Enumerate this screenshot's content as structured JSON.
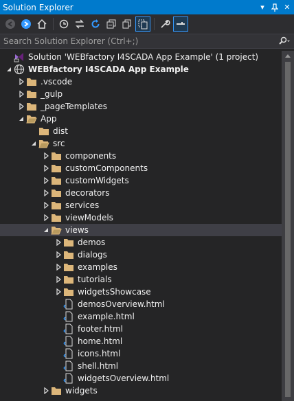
{
  "window": {
    "title": "Solution Explorer",
    "dropdown_icon": "caret-down-icon",
    "pin_icon": "pin-icon",
    "close_icon": "close-icon"
  },
  "toolbar": {
    "buttons": [
      "back-arrow-icon",
      "forward-arrow-icon",
      "home-icon",
      "history-icon",
      "sync-icon",
      "refresh-icon",
      "collapse-all-icon",
      "copy-icon",
      "show-all-files-icon",
      "properties-wrench-icon",
      "preview-icon"
    ]
  },
  "search": {
    "placeholder": "Search Solution Explorer (Ctrl+;)",
    "icon": "search-icon"
  },
  "tree": {
    "rows": [
      {
        "label": "Solution 'WEBfactory I4SCADA App Example' (1 project)",
        "type": "solution",
        "bold": false
      },
      {
        "label": "WEBfactory I4SCADA App Example",
        "type": "project",
        "bold": true
      },
      {
        "label": ".vscode",
        "type": "folder"
      },
      {
        "label": "_gulp",
        "type": "folder"
      },
      {
        "label": "_pageTemplates",
        "type": "folder"
      },
      {
        "label": "App",
        "type": "folder-open"
      },
      {
        "label": "dist",
        "type": "folder"
      },
      {
        "label": "src",
        "type": "folder-open"
      },
      {
        "label": "components",
        "type": "folder"
      },
      {
        "label": "customComponents",
        "type": "folder"
      },
      {
        "label": "customWidgets",
        "type": "folder"
      },
      {
        "label": "decorators",
        "type": "folder"
      },
      {
        "label": "services",
        "type": "folder"
      },
      {
        "label": "viewModels",
        "type": "folder"
      },
      {
        "label": "views",
        "type": "folder-open"
      },
      {
        "label": "demos",
        "type": "folder"
      },
      {
        "label": "dialogs",
        "type": "folder"
      },
      {
        "label": "examples",
        "type": "folder"
      },
      {
        "label": "tutorials",
        "type": "folder"
      },
      {
        "label": "widgetsShowcase",
        "type": "folder"
      },
      {
        "label": "demosOverview.html",
        "type": "html-file"
      },
      {
        "label": "example.html",
        "type": "html-file"
      },
      {
        "label": "footer.html",
        "type": "html-file"
      },
      {
        "label": "home.html",
        "type": "html-file"
      },
      {
        "label": "icons.html",
        "type": "html-file"
      },
      {
        "label": "shell.html",
        "type": "html-file"
      },
      {
        "label": "widgetsOverview.html",
        "type": "html-file"
      },
      {
        "label": "widgets",
        "type": "folder"
      }
    ]
  },
  "colors": {
    "accent": "#007acc",
    "background": "#252526",
    "selected_row": "#3f3f46",
    "folder": "#dcb67a",
    "text": "#f1f1f1"
  }
}
